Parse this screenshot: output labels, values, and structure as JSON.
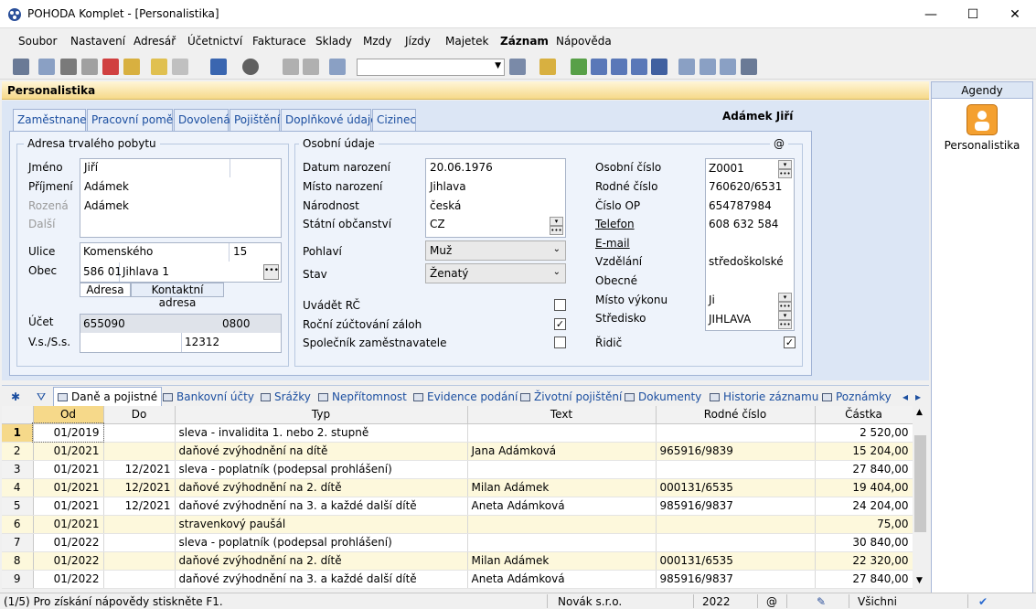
{
  "window": {
    "title": "POHODA Komplet - [Personalistika]",
    "minimize": "—",
    "maximize": "☐",
    "close": "✕"
  },
  "menu": [
    "Soubor",
    "Nastavení",
    "Adresář",
    "Účetnictví",
    "Fakturace",
    "Sklady",
    "Mzdy",
    "Jízdy",
    "Majetek",
    "Záznam",
    "Nápověda"
  ],
  "agenda": {
    "header": "Agendy",
    "item_label": "Personalistika"
  },
  "section_title": "Personalistika",
  "employee_name": "Adámek Jiří",
  "tabs": [
    "Zaměstnanec",
    "Pracovní poměr",
    "Dovolená",
    "Pojištění",
    "Doplňkové údaje",
    "Cizinec"
  ],
  "address": {
    "group_title": "Adresa trvalého pobytu",
    "labels": {
      "jmeno": "Jméno",
      "prijmeni": "Příjmení",
      "rozena": "Rozená",
      "dalsi": "Další",
      "ulice": "Ulice",
      "obec": "Obec",
      "ucet": "Účet",
      "vss": "V.s./S.s."
    },
    "jmeno": "Jiří",
    "prijmeni": "Adámek",
    "rozena": "Adámek",
    "ulice": "Komenského",
    "cislo": "15",
    "psc": "586 01",
    "obec": "Jihlava 1",
    "subtab_active": "Adresa",
    "subtab_other": "Kontaktní adresa",
    "ucet": "655090",
    "kod_banky": "0800",
    "ss": "12312"
  },
  "personal": {
    "group_title": "Osobní údaje",
    "at": "@",
    "labels": {
      "datum": "Datum narození",
      "misto": "Místo narození",
      "narodnost": "Národnost",
      "obcanstvi": "Státní občanství",
      "pohlavi": "Pohlaví",
      "stav": "Stav",
      "uvadet_rc": "Uvádět RČ",
      "rocni": "Roční zúčtování záloh",
      "spolecnik": "Společník zaměstnavatele"
    },
    "datum": "20.06.1976",
    "misto": "Jihlava",
    "narodnost": "česká",
    "obcanstvi": "CZ",
    "pohlavi": "Muž",
    "stav": "Ženatý",
    "uvadet_rc": false,
    "rocni": true,
    "spolecnik": false
  },
  "ids": {
    "labels": {
      "osobni": "Osobní číslo",
      "rodne": "Rodné číslo",
      "op": "Číslo OP",
      "telefon": "Telefon",
      "email": "E-mail",
      "vzdelani": "Vzdělání",
      "obecne": "Obecné",
      "misto_vykonu": "Místo výkonu",
      "stredisko": "Středisko",
      "ridic": "Řidič"
    },
    "osobni": "Z0001",
    "rodne": "760620/6531",
    "op": "654787984",
    "telefon": "608 632 584",
    "vzdelani": "středoškolské",
    "misto_vykonu": "Ji",
    "stredisko": "JIHLAVA",
    "ridic": true
  },
  "bottom_tabs": [
    "Daně a pojistné",
    "Bankovní účty",
    "Srážky",
    "Nepřítomnost",
    "Evidence podání",
    "Životní pojištění",
    "Dokumenty",
    "Historie záznamu",
    "Poznámky"
  ],
  "grid": {
    "columns": [
      "Od",
      "Do",
      "Typ",
      "Text",
      "Rodné číslo",
      "Částka"
    ],
    "rows": [
      {
        "n": "1",
        "od": "01/2019",
        "do": "",
        "typ": "sleva - invalidita 1. nebo 2. stupně",
        "text": "",
        "rc": "",
        "castka": "2 520,00"
      },
      {
        "n": "2",
        "od": "01/2021",
        "do": "",
        "typ": "daňové zvýhodnění na dítě",
        "text": "Jana Adámková",
        "rc": "965916/9839",
        "castka": "15 204,00"
      },
      {
        "n": "3",
        "od": "01/2021",
        "do": "12/2021",
        "typ": "sleva - poplatník (podepsal prohlášení)",
        "text": "",
        "rc": "",
        "castka": "27 840,00"
      },
      {
        "n": "4",
        "od": "01/2021",
        "do": "12/2021",
        "typ": "daňové zvýhodnění na 2. dítě",
        "text": "Milan Adámek",
        "rc": "000131/6535",
        "castka": "19 404,00"
      },
      {
        "n": "5",
        "od": "01/2021",
        "do": "12/2021",
        "typ": "daňové zvýhodnění na 3. a každé další dítě",
        "text": "Aneta Adámková",
        "rc": "985916/9837",
        "castka": "24 204,00"
      },
      {
        "n": "6",
        "od": "01/2021",
        "do": "",
        "typ": "stravenkový paušál",
        "text": "",
        "rc": "",
        "castka": "75,00"
      },
      {
        "n": "7",
        "od": "01/2022",
        "do": "",
        "typ": "sleva - poplatník (podepsal prohlášení)",
        "text": "",
        "rc": "",
        "castka": "30 840,00"
      },
      {
        "n": "8",
        "od": "01/2022",
        "do": "",
        "typ": "daňové zvýhodnění na 2. dítě",
        "text": "Milan Adámek",
        "rc": "000131/6535",
        "castka": "22 320,00"
      },
      {
        "n": "9",
        "od": "01/2022",
        "do": "",
        "typ": "daňové zvýhodnění na 3. a každé další dítě",
        "text": "Aneta Adámková",
        "rc": "985916/9837",
        "castka": "27 840,00"
      }
    ]
  },
  "status": {
    "help": "(1/5) Pro získání nápovědy stiskněte F1.",
    "company": "Novák s.r.o.",
    "year": "2022",
    "at": "@",
    "filter": "Všichni"
  },
  "colors": {
    "accent": "#1c4fa0",
    "header_gold": "#f6d98a",
    "panel": "#dce6f5"
  }
}
